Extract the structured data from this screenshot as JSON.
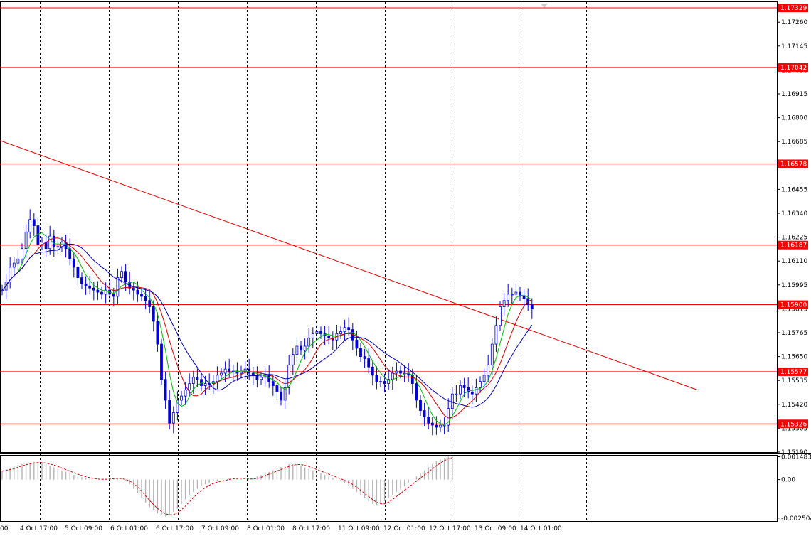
{
  "colors": {
    "background": "#ffffff",
    "grid": "#000000",
    "candle": "#0000cc",
    "ma_fast": "#00bb00",
    "ma_medium": "#cc0000",
    "ma_slow": "#0000aa",
    "level": "#ff0000",
    "trendline": "#dd0000",
    "osc_bar": "#b4b4b4",
    "osc_signal": "#cc0000",
    "current_price": "#000000"
  },
  "chart_data": [
    {
      "type": "candlestick",
      "title": "",
      "xlabel": "",
      "ylabel": "",
      "ylim": [
        1.1519,
        1.1736
      ],
      "grid": true,
      "y_tick_labels": [
        "1.17260",
        "1.17145",
        "1.17030",
        "1.16915",
        "1.16800",
        "1.16685",
        "1.16570",
        "1.16455",
        "1.16340",
        "1.16225",
        "1.16110",
        "1.15995",
        "1.15879",
        "1.15765",
        "1.15650",
        "1.15535",
        "1.15420",
        "1.15305",
        "1.15190"
      ],
      "x_tick_labels": [
        "4 Oct 17:00",
        "5 Oct 09:00",
        "6 Oct 01:00",
        "6 Oct 17:00",
        "7 Oct 09:00",
        "8 Oct 01:00",
        "8 Oct 17:00",
        "11 Oct 09:00",
        "12 Oct 01:00",
        "12 Oct 17:00",
        "13 Oct 09:00",
        "14 Oct 01:00"
      ],
      "x_tick_start_label": "00",
      "horizontal_levels": [
        "1.17329",
        "1.17042",
        "1.16578",
        "1.16187",
        "1.15900",
        "1.15577",
        "1.15326"
      ],
      "current_price": "1.15879",
      "trendline": {
        "start": [
          0,
          1.1669
        ],
        "end": [
          175,
          1.1549
        ]
      },
      "indicators": [
        "MA fast (green)",
        "MA medium (red)",
        "MA slow (blue)"
      ],
      "candles_close": [
        1.1597,
        1.1601,
        1.1608,
        1.161,
        1.1612,
        1.1617,
        1.1625,
        1.1631,
        1.1628,
        1.1619,
        1.162,
        1.1617,
        1.1623,
        1.1618,
        1.1618,
        1.162,
        1.1617,
        1.1612,
        1.1608,
        1.1603,
        1.16,
        1.1599,
        1.1598,
        1.1597,
        1.1596,
        1.1595,
        1.1597,
        1.1595,
        1.1594,
        1.1603,
        1.1606,
        1.1601,
        1.1598,
        1.1597,
        1.1595,
        1.1594,
        1.1592,
        1.1589,
        1.1582,
        1.1571,
        1.1554,
        1.1544,
        1.1533,
        1.1538,
        1.1544,
        1.1546,
        1.1549,
        1.1552,
        1.1555,
        1.1554,
        1.1551,
        1.1552,
        1.1552,
        1.1553,
        1.1556,
        1.1557,
        1.1559,
        1.1558,
        1.1558,
        1.1557,
        1.1558,
        1.1559,
        1.1557,
        1.1556,
        1.1554,
        1.1555,
        1.1556,
        1.1553,
        1.1551,
        1.1548,
        1.1544,
        1.155,
        1.1561,
        1.1566,
        1.157,
        1.1568,
        1.157,
        1.1574,
        1.1576,
        1.1577,
        1.1576,
        1.1575,
        1.1574,
        1.1573,
        1.1576,
        1.1577,
        1.1579,
        1.1578,
        1.1573,
        1.1569,
        1.1565,
        1.1564,
        1.156,
        1.1556,
        1.1553,
        1.1553,
        1.1552,
        1.1554,
        1.1557,
        1.1558,
        1.1557,
        1.1557,
        1.1556,
        1.1552,
        1.1544,
        1.1539,
        1.1536,
        1.1533,
        1.1532,
        1.1531,
        1.1532,
        1.1532,
        1.154,
        1.1547,
        1.1547,
        1.1551,
        1.155,
        1.1548,
        1.1547,
        1.155,
        1.1553,
        1.1556,
        1.1561,
        1.1571,
        1.158,
        1.1589,
        1.1592,
        1.1595,
        1.1595,
        1.1596,
        1.1594,
        1.1593,
        1.159,
        1.1588
      ]
    },
    {
      "type": "histogram",
      "title": "",
      "ylim": [
        -0.0027,
        0.0016
      ],
      "y_tick_labels": [
        "0.001483",
        "0.00",
        "-0.002504"
      ],
      "histogram": [
        0.00055,
        0.00065,
        0.00075,
        0.00085,
        0.00095,
        0.001,
        0.00105,
        0.0011,
        0.00115,
        0.0011,
        0.00105,
        0.001,
        0.0009,
        0.0008,
        0.0007,
        0.0006,
        0.0005,
        0.0004,
        0.0003,
        0.0002,
        0.00015,
        0.0001,
        5e-05,
        0.0,
        0.0,
        0.0,
        5e-05,
        0.0001,
        0.0001,
        5e-05,
        0.0,
        -0.0001,
        -0.0003,
        -0.0006,
        -0.0009,
        -0.0012,
        -0.0015,
        -0.0018,
        -0.002,
        -0.0022,
        -0.0023,
        -0.0024,
        -0.0023,
        -0.0021,
        -0.0019,
        -0.0016,
        -0.0013,
        -0.001,
        -0.0008,
        -0.0006,
        -0.0004,
        -0.0003,
        -0.0002,
        -0.0001,
        -0.0001,
        0.0,
        0.0,
        0.0001,
        0.0001,
        0.0001,
        5e-05,
        0.0,
        0.0,
        0.0001,
        0.0002,
        0.0003,
        0.0004,
        0.0005,
        0.0006,
        0.0007,
        0.0008,
        0.0009,
        0.001,
        0.001,
        0.001,
        0.0009,
        0.0008,
        0.0007,
        0.0006,
        0.0005,
        0.0004,
        0.0003,
        0.0002,
        0.0001,
        0.0,
        -0.0001,
        -0.0002,
        -0.0004,
        -0.0006,
        -0.0008,
        -0.001,
        -0.0012,
        -0.0014,
        -0.0016,
        -0.0017,
        -0.0016,
        -0.0014,
        -0.0012,
        -0.001,
        -0.0008,
        -0.0006,
        -0.0004,
        -0.0002,
        0.0,
        0.0002,
        0.0004,
        0.0006,
        0.0008,
        0.001,
        0.0012,
        0.0013,
        0.0014,
        0.0015,
        0.0015
      ]
    }
  ]
}
